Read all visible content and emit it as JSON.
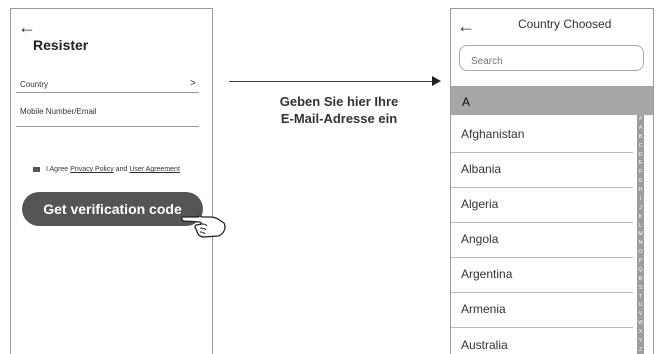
{
  "register": {
    "back_icon": "back-arrow-icon",
    "title": "Resister",
    "country_label": "Country",
    "country_chevron": ">",
    "mobile_label": "Mobile Number/Email",
    "agree_prefix": "I Agree",
    "privacy_link": "Privacy Policy",
    "and_text": "and",
    "agreement_link": "User Agreement",
    "verify_button": "Get verification code",
    "button_color": "#555555"
  },
  "caption": {
    "line1": "Geben Sie hier Ihre",
    "line2": "E-Mail-Adresse ein"
  },
  "country_picker": {
    "back_icon": "back-arrow-icon",
    "title": "Country Choosed",
    "search_placeholder": "Search",
    "section_letter": "A",
    "section_color": "#a6a6a6",
    "countries": [
      "Afghanistan",
      "Albania",
      "Algeria",
      "Angola",
      "Argentina",
      "Armenia",
      "Australia"
    ],
    "alphabet": [
      "#",
      "A",
      "B",
      "C",
      "D",
      "E",
      "F",
      "G",
      "H",
      "I",
      "J",
      "K",
      "L",
      "M",
      "N",
      "O",
      "P",
      "Q",
      "R",
      "S",
      "T",
      "U",
      "V",
      "W",
      "X",
      "Y",
      "Z"
    ]
  }
}
